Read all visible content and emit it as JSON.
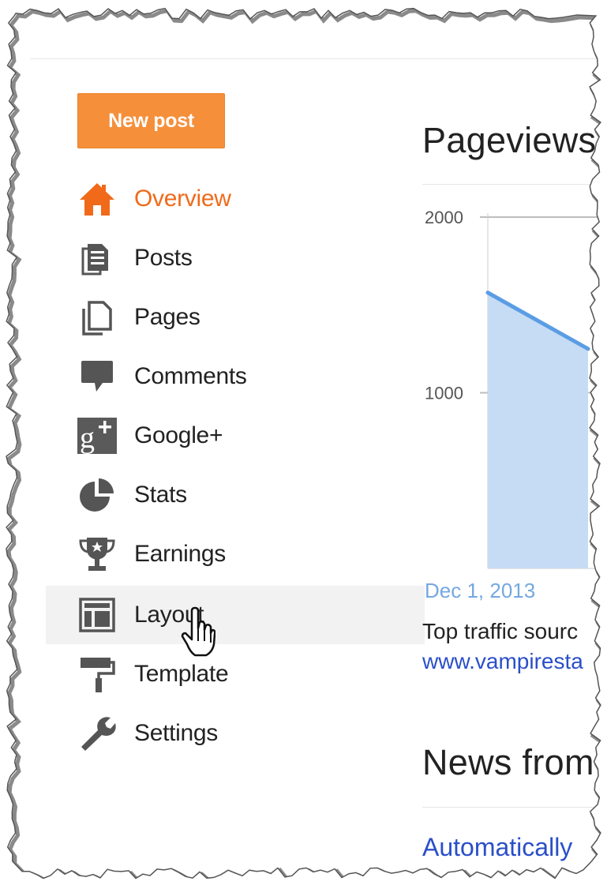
{
  "sidebar": {
    "new_post_label": "New post",
    "items": [
      {
        "label": "Overview",
        "icon": "home-icon",
        "current": true
      },
      {
        "label": "Posts",
        "icon": "posts-icon"
      },
      {
        "label": "Pages",
        "icon": "pages-icon"
      },
      {
        "label": "Comments",
        "icon": "comment-icon"
      },
      {
        "label": "Google+",
        "icon": "google-plus-icon"
      },
      {
        "label": "Stats",
        "icon": "pie-chart-icon"
      },
      {
        "label": "Earnings",
        "icon": "trophy-icon"
      },
      {
        "label": "Layout",
        "icon": "layout-icon",
        "hovered": true
      },
      {
        "label": "Template",
        "icon": "paint-roller-icon"
      },
      {
        "label": "Settings",
        "icon": "wrench-icon"
      }
    ]
  },
  "main": {
    "pageviews_title": "Pageviews",
    "date_label": "Dec 1, 2013",
    "traffic_text": "Top traffic sourc",
    "traffic_link": "www.vampiresta",
    "news_title": "News from",
    "auto_link": "Automatically"
  },
  "chart_data": {
    "type": "area",
    "y_ticks": [
      "2000",
      "1000"
    ],
    "ylim": [
      0,
      2000
    ],
    "x": [
      "Dec 1, 2013",
      ""
    ],
    "values": [
      1570,
      1250
    ],
    "line_color": "#5b9de4",
    "fill_color": "#c6dcf5"
  },
  "colors": {
    "accent_orange": "#f58f3a",
    "overview_orange": "#f06a1a",
    "link_blue": "#2a4fc9"
  }
}
